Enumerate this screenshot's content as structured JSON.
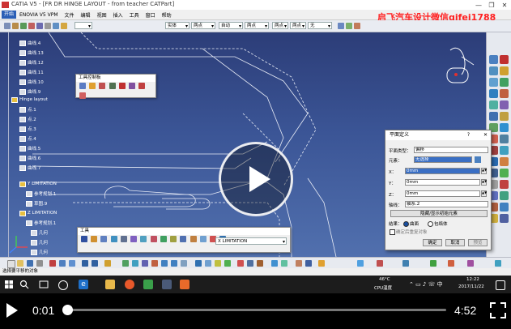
{
  "window": {
    "title": "CATIA V5 - [FR DR HINGE LAYOUT - from teacher CATPart]",
    "controls": [
      "—",
      "❐",
      "✕"
    ]
  },
  "menu": {
    "start": "开始",
    "items": [
      "ENOVIA V5 VPM",
      "文件",
      "编辑",
      "视图",
      "插入",
      "工具",
      "窗口",
      "帮助"
    ]
  },
  "watermark": "启飞汽车设计微信qifei1788",
  "toolbar_dropdowns": [
    "实体",
    "两点",
    "自动",
    "两点",
    "两点",
    "两点",
    "无"
  ],
  "tree": {
    "items": [
      "曲线.4",
      "曲线.13",
      "曲线.12",
      "曲线.11",
      "曲线.10",
      "曲线.9",
      "Hinge layout",
      "点.1",
      "点.2",
      "点.3",
      "点.4",
      "曲线.5",
      "曲线.6",
      "曲线.7",
      "Y LIMITATION",
      "参考规划.1",
      "草图.9",
      "Z LIMITATION",
      "参考规划.1",
      "几何",
      "几何",
      "几何"
    ]
  },
  "tool_panel": {
    "title": "工具控制板"
  },
  "tools_panel": {
    "title": "工具",
    "dropdown": "X LIMITATION"
  },
  "plane_dialog": {
    "title": "平面定义",
    "help": "?",
    "close": "✕",
    "type_label": "平面类型：",
    "type_value": "偏移",
    "element_label": "元素：",
    "element_value": "无选择",
    "x_label": "X：",
    "x_value": "0mm",
    "y_label": "Y：",
    "y_value": "0mm",
    "z_label": "Z：",
    "z_value": "0mm",
    "axis_label": "轴线：",
    "axis_value": "轴系.2",
    "reset_button": "隐藏/显示初始元素",
    "result_label": "结果：",
    "result_option1": "曲面",
    "result_option2": "包络体",
    "checkbox_label": "确定后重复对象",
    "ok": "确定",
    "cancel": "取消",
    "preview": "预览"
  },
  "status_bar": {
    "text": "选择要平移的对象"
  },
  "taskbar": {
    "temperature": "46°C",
    "cpu": "CPU温度",
    "time": "12:22",
    "date": "2017/11/22"
  },
  "player": {
    "current_time": "0:01",
    "total_time": "4:52",
    "progress": 0.004
  },
  "colors": {
    "viewport_top": "#2c3d78",
    "viewport_bottom": "#5170ae",
    "watermark": "#ff2020",
    "selection": "#3a6fc4"
  }
}
